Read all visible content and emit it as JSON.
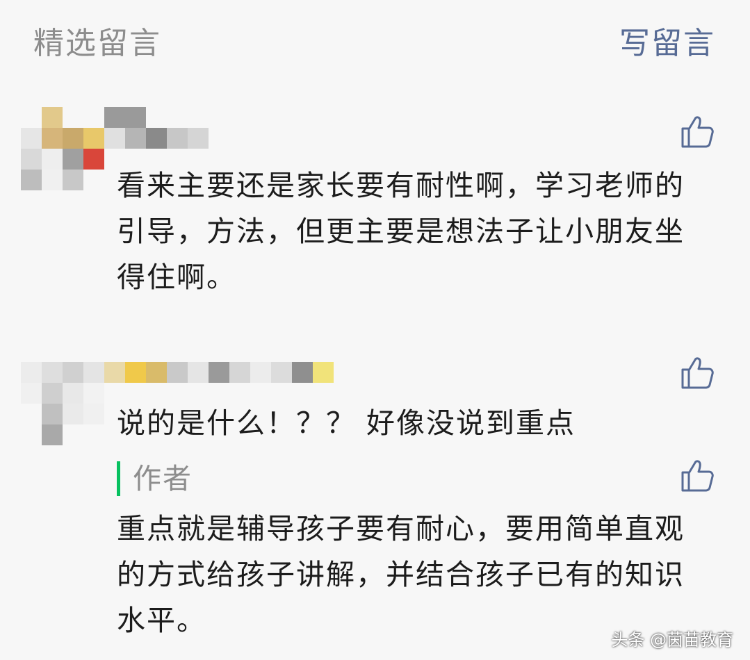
{
  "header": {
    "title": "精选留言",
    "write_label": "写留言"
  },
  "comments": [
    {
      "text": "看来主要还是家长要有耐性啊，学习老师的引导，方法，但更主要是想法子让小朋友坐得住啊。",
      "like_icon": "thumbs-up-icon"
    },
    {
      "text": "说的是什么！？？ 好像没说到重点",
      "like_icon": "thumbs-up-icon",
      "reply": {
        "author_label": "作者",
        "text": "重点就是辅导孩子要有耐心，要用简单直观的方式给孩子讲解，并结合孩子已有的知识水平。",
        "like_icon": "thumbs-up-icon"
      }
    }
  ],
  "watermark": "头条 @茵苗教育",
  "colors": {
    "link": "#576b95",
    "author_bar": "#07c160",
    "text": "#1c1c1c",
    "muted": "#8d8d8d",
    "icon": "#576b95"
  }
}
